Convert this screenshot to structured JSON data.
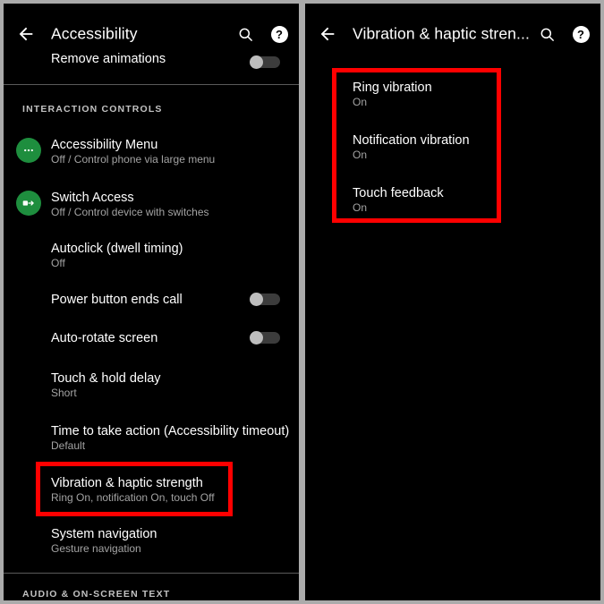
{
  "left_panel": {
    "appbar": {
      "back_icon": "arrow-left-icon",
      "title": "Accessibility",
      "search_icon": "search-icon",
      "help_icon": "help-circle-icon",
      "help_glyph": "?"
    },
    "clipped_row": {
      "title": "Remove animations",
      "toggle_state": "off"
    },
    "section_label": "INTERACTION CONTROLS",
    "bottom_section_label": "AUDIO & ON-SCREEN TEXT",
    "rows": [
      {
        "title": "Accessibility Menu",
        "subtitle": "Off / Control phone via large menu",
        "icon": "dots-menu-icon",
        "icon_color": "#1e8e3e",
        "has_toggle": false
      },
      {
        "title": "Switch Access",
        "subtitle": "Off / Control device with switches",
        "icon": "switch-access-icon",
        "icon_color": "#1e8e3e",
        "has_toggle": false
      },
      {
        "title": "Autoclick (dwell timing)",
        "subtitle": "Off",
        "icon": null,
        "has_toggle": false
      },
      {
        "title": "Power button ends call",
        "subtitle": null,
        "icon": null,
        "has_toggle": true,
        "toggle_state": "off"
      },
      {
        "title": "Auto-rotate screen",
        "subtitle": null,
        "icon": null,
        "has_toggle": true,
        "toggle_state": "off"
      },
      {
        "title": "Touch & hold delay",
        "subtitle": "Short",
        "icon": null,
        "has_toggle": false
      },
      {
        "title": "Time to take action (Accessibility timeout)",
        "subtitle": "Default",
        "icon": null,
        "has_toggle": false
      },
      {
        "title": "Vibration & haptic strength",
        "subtitle": "Ring On, notification On, touch Off",
        "icon": null,
        "has_toggle": false,
        "highlighted": true
      },
      {
        "title": "System navigation",
        "subtitle": "Gesture navigation",
        "icon": null,
        "has_toggle": false
      }
    ]
  },
  "right_panel": {
    "appbar": {
      "back_icon": "arrow-left-icon",
      "title": "Vibration & haptic stren...",
      "search_icon": "search-icon",
      "help_icon": "help-circle-icon",
      "help_glyph": "?"
    },
    "rows": [
      {
        "title": "Ring vibration",
        "subtitle": "On"
      },
      {
        "title": "Notification vibration",
        "subtitle": "On"
      },
      {
        "title": "Touch feedback",
        "subtitle": "On"
      }
    ]
  },
  "annotations": {
    "highlight_color": "#ff0000",
    "boxes": [
      {
        "name": "vibration-haptic-strength-highlight",
        "panel": "left"
      },
      {
        "name": "vibration-options-highlight",
        "panel": "right"
      }
    ]
  }
}
